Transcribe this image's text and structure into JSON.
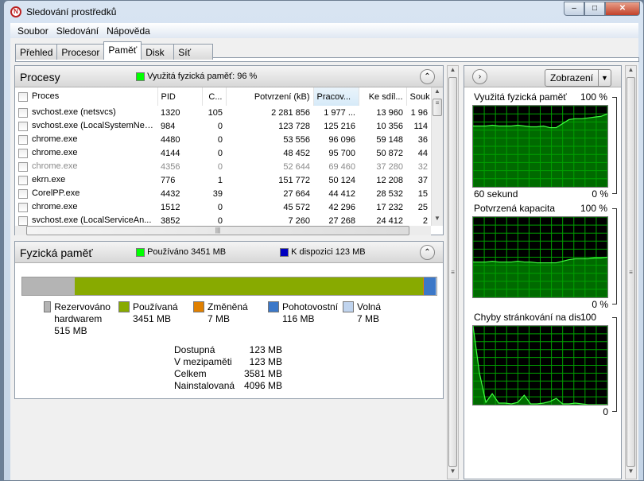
{
  "window": {
    "title": "Sledování prostředků",
    "controls": [
      "minimize",
      "maximize",
      "close"
    ]
  },
  "menu": [
    "Soubor",
    "Sledování",
    "Nápověda"
  ],
  "tabs": [
    {
      "label": "Přehled"
    },
    {
      "label": "Procesor"
    },
    {
      "label": "Paměť",
      "active": true
    },
    {
      "label": "Disk"
    },
    {
      "label": "Síť"
    }
  ],
  "processes": {
    "title": "Procesy",
    "indicator": "Využitá fyzická paměť: 96 %",
    "indicator_color": "#00ff00",
    "columns": [
      "Proces",
      "PID",
      "C...",
      "Potvrzení (kB)",
      "Pracov...",
      "Ke sdíl...",
      "Souk"
    ],
    "rows": [
      [
        "svchost.exe (netsvcs)",
        "1320",
        "105",
        "2 281 856",
        "1 977 ...",
        "13 960",
        "1 96"
      ],
      [
        "svchost.exe (LocalSystemNet...",
        "984",
        "0",
        "123 728",
        "125 216",
        "10 356",
        "114"
      ],
      [
        "chrome.exe",
        "4480",
        "0",
        "53 556",
        "96 096",
        "59 148",
        "36"
      ],
      [
        "chrome.exe",
        "4144",
        "0",
        "48 452",
        "95 700",
        "50 872",
        "44"
      ],
      [
        "chrome.exe",
        "4356",
        "0",
        "52 644",
        "69 460",
        "37 280",
        "32"
      ],
      [
        "ekrn.exe",
        "776",
        "1",
        "151 772",
        "50 124",
        "12 208",
        "37"
      ],
      [
        "CorelPP.exe",
        "4432",
        "39",
        "27 664",
        "44 412",
        "28 532",
        "15"
      ],
      [
        "chrome.exe",
        "1512",
        "0",
        "45 572",
        "42 296",
        "17 232",
        "25"
      ],
      [
        "svchost.exe (LocalServiceAn...",
        "3852",
        "0",
        "7 260",
        "27 268",
        "24 412",
        "2"
      ]
    ],
    "dimmed_row": 4
  },
  "physical": {
    "title": "Fyzická paměť",
    "used_label": "Používáno 3451 MB",
    "used_color": "#00ff00",
    "avail_label": "K dispozici 123 MB",
    "avail_color": "#0000c0",
    "segments": [
      {
        "label": "Rezervováno hardwarem",
        "value": "515 MB",
        "mb": 515,
        "color": "#b4b4b4"
      },
      {
        "label": "Používaná",
        "value": "3451 MB",
        "mb": 3451,
        "color": "#88aa00"
      },
      {
        "label": "Změněná",
        "value": "7 MB",
        "mb": 7,
        "color": "#e08000"
      },
      {
        "label": "Pohotovostní",
        "value": "116 MB",
        "mb": 116,
        "color": "#3c78c8"
      },
      {
        "label": "Volná",
        "value": "7 MB",
        "mb": 7,
        "color": "#c0d4ee"
      }
    ],
    "stats": [
      {
        "k": "Dostupná",
        "v": "123 MB"
      },
      {
        "k": "V mezipaměti",
        "v": "123 MB"
      },
      {
        "k": "Celkem",
        "v": "3581 MB"
      },
      {
        "k": "Nainstalovaná",
        "v": "4096 MB"
      }
    ]
  },
  "graphs": {
    "view_button": "Zobrazení",
    "items": [
      {
        "title": "Využitá fyzická paměť",
        "max": "100 %",
        "min": "0 %",
        "xlabel": "60 sekund",
        "values": [
          75,
          75,
          75,
          76,
          75,
          75,
          75,
          76,
          75,
          74,
          74,
          75,
          73,
          73,
          78,
          83,
          84,
          84,
          85,
          86,
          87,
          90
        ]
      },
      {
        "title": "Potvrzená kapacita",
        "max": "100 %",
        "min": "0 %",
        "values": [
          44,
          44,
          44,
          45,
          44,
          44,
          44,
          45,
          44,
          44,
          43,
          43,
          43,
          43,
          45,
          47,
          48,
          48,
          48,
          49,
          49,
          50
        ]
      },
      {
        "title": "Chyby stránkování na dis...",
        "max": "100",
        "min": "0",
        "values": [
          100,
          40,
          3,
          14,
          2,
          2,
          1,
          3,
          12,
          1,
          1,
          2,
          4,
          8,
          1,
          1,
          2,
          1,
          0,
          0,
          0,
          0
        ]
      }
    ]
  }
}
